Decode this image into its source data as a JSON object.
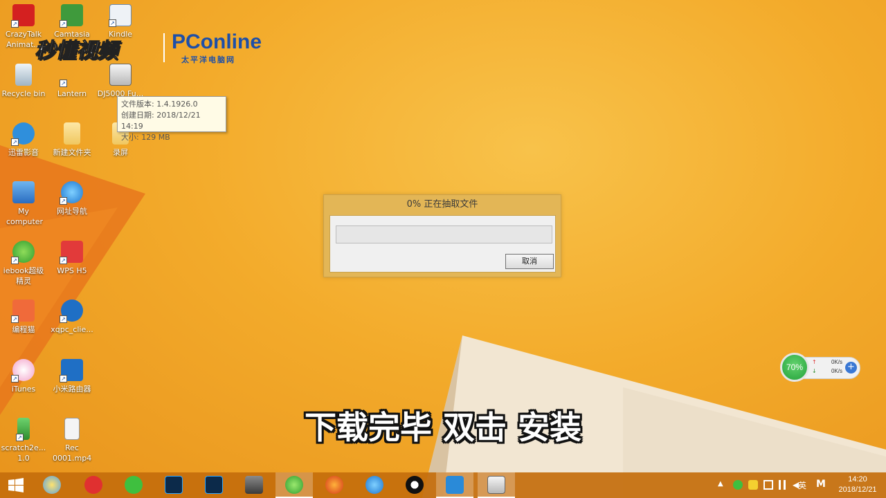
{
  "desktop_icons": [
    {
      "label": "CrazyTalk Animat...",
      "icon": "crazytalk-icon"
    },
    {
      "label": "Camtasia",
      "icon": "camtasia-icon"
    },
    {
      "label": "Kindle",
      "icon": "kindle-icon"
    },
    {
      "label": "Recycle bin",
      "icon": "recycle-bin-icon"
    },
    {
      "label": "Lantern",
      "icon": "lantern-icon"
    },
    {
      "label": "DJ5000 Fu...",
      "icon": "installer-icon"
    },
    {
      "label": "迅雷影音",
      "icon": "xunlei-player-icon"
    },
    {
      "label": "新建文件夹",
      "icon": "folder-icon"
    },
    {
      "label": "录屏",
      "icon": "folder-icon"
    },
    {
      "label": "My computer",
      "icon": "computer-icon"
    },
    {
      "label": "网址导航",
      "icon": "ie-icon"
    },
    {
      "label": "iebook超级精灵",
      "icon": "iebook-icon"
    },
    {
      "label": "WPS H5",
      "icon": "wps-h5-icon"
    },
    {
      "label": "编程猫",
      "icon": "codemao-icon"
    },
    {
      "label": "xqpc_clie...",
      "icon": "wifi-app-icon"
    },
    {
      "label": "iTunes",
      "icon": "itunes-icon"
    },
    {
      "label": "小米路由器",
      "icon": "router-icon"
    },
    {
      "label": "scratch2e... 1.0",
      "icon": "scratch-icon"
    },
    {
      "label": "Rec 0001.mp4",
      "icon": "mp4-file-icon"
    }
  ],
  "logo": {
    "cn_text": "秒懂视频",
    "pc_text": "PConline",
    "pc_sub": "太平洋电脑网"
  },
  "tooltip": {
    "line1": "文件版本: 1.4.1926.0",
    "line2": "创建日期: 2018/12/21 14:19",
    "line3": "大小: 129 MB"
  },
  "dialog": {
    "title": "0% 正在抽取文件",
    "progress": 0,
    "cancel_label": "取消"
  },
  "subtitle": "下载完毕 双击 安装",
  "net_widget": {
    "percent": "70%",
    "up_rate": "0K/s",
    "down_rate": "0K/s"
  },
  "taskbar": {
    "items": [
      "start-icon",
      "360-browser-icon",
      "netease-music-icon",
      "wechat-icon",
      "photoshop-icon",
      "photoshop-icon",
      "app-icon",
      "360-security-icon",
      "firefox-icon",
      "ie-icon",
      "qq-icon",
      "screen-recorder-icon",
      "installer-icon"
    ],
    "ime_label": "英",
    "ime_mode": "M",
    "time": "14:20",
    "date": "2018/12/21"
  },
  "colors": {
    "wallpaper": "#f2a92a",
    "taskbar": "#c46e0c",
    "dialog_frame": "#e3b656",
    "widget_green": "#23a23a"
  }
}
